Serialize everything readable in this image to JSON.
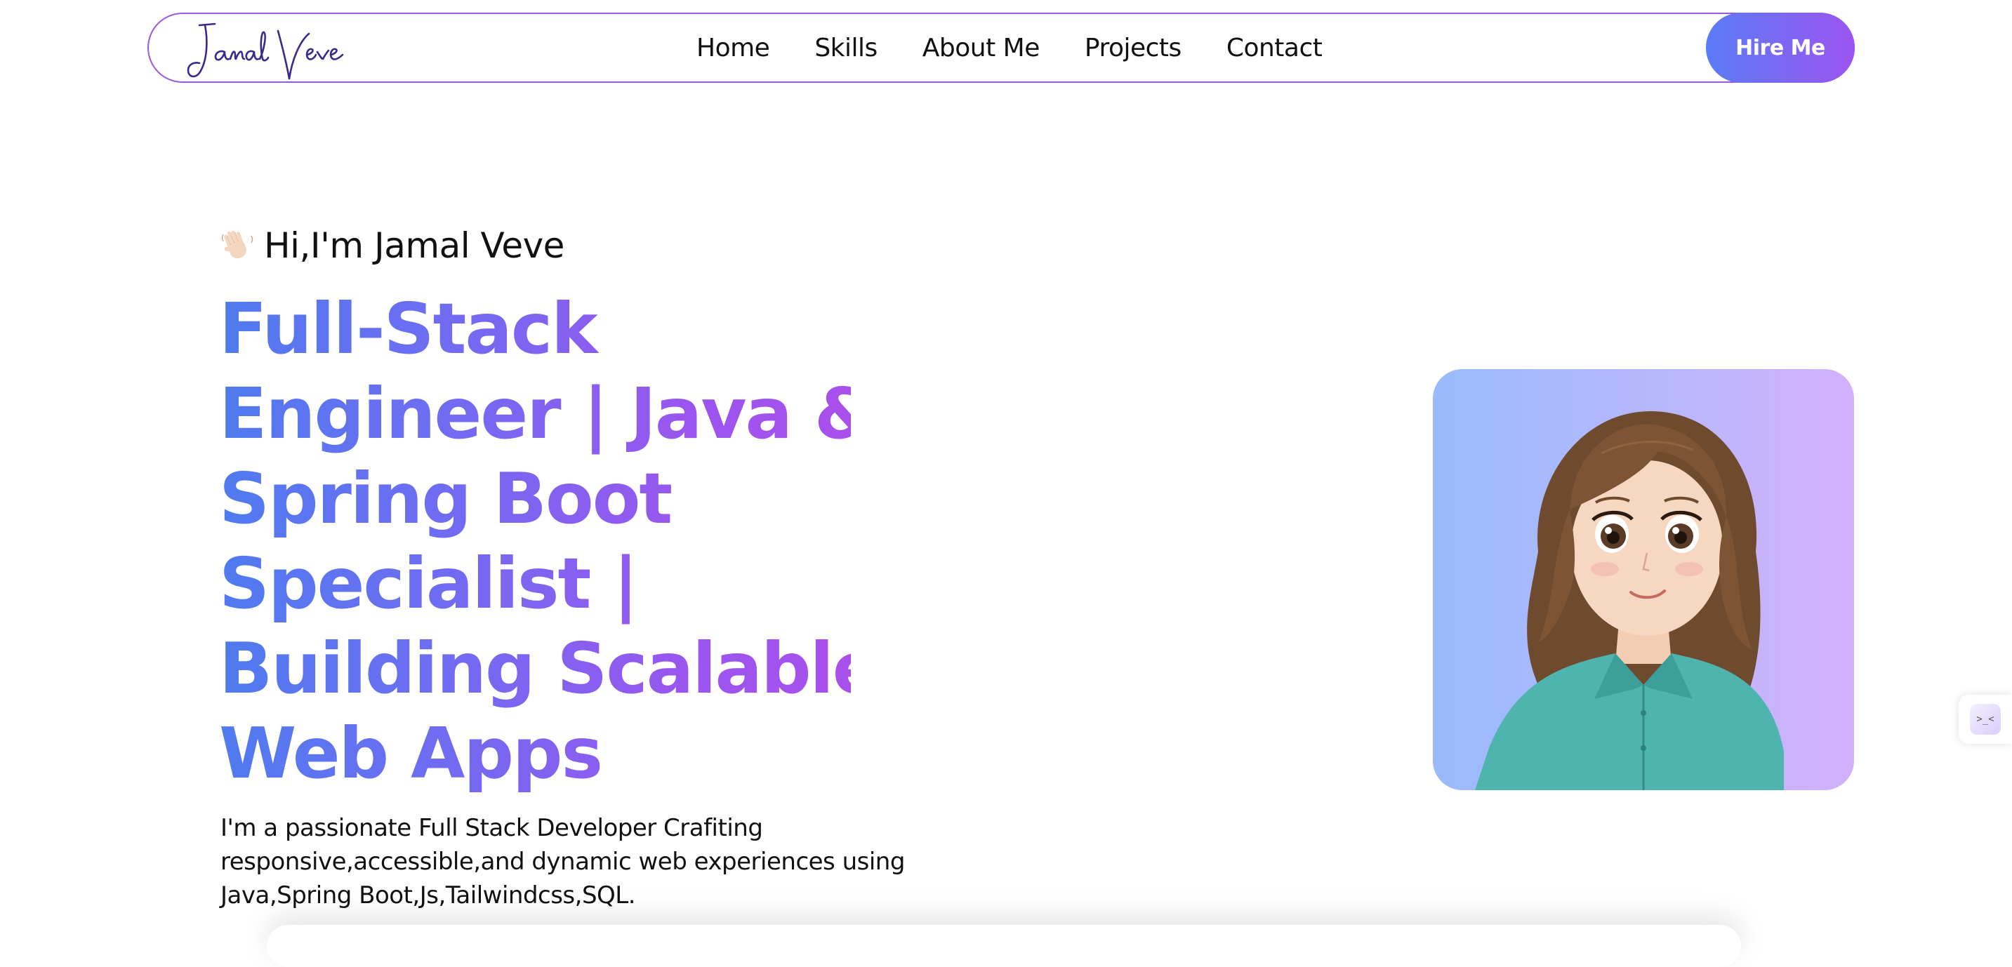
{
  "brand": {
    "logo_text": "Jamal Veve",
    "logo_color": "#3a2a8c"
  },
  "nav": {
    "links": [
      {
        "label": "Home"
      },
      {
        "label": "Skills"
      },
      {
        "label": "About Me"
      },
      {
        "label": "Projects"
      },
      {
        "label": "Contact"
      }
    ],
    "cta_label": "Hire Me"
  },
  "hero": {
    "greeting_icon": "waving-hand-icon",
    "greeting": "Hi,I'm Jamal Veve",
    "headline_lines": [
      "Full-Stack",
      "Engineer | Java &",
      "Spring Boot",
      "Specialist |",
      "Building Scalable",
      "Web Apps"
    ],
    "description_lines": [
      "I'm a passionate Full Stack Developer Crafiting",
      "responsive,accessible,and dynamic web experiences using",
      "Java,Spring Boot,Js,Tailwindcss,SQL."
    ],
    "avatar_icon": "cartoon-avatar-portrait"
  },
  "side_widget": {
    "icon": "code-brackets-icon",
    "glyph": ">_<"
  },
  "colors": {
    "accent_start": "#4f7bef",
    "accent_end": "#a94fec",
    "nav_border": "#9a5ad8",
    "text": "#111111",
    "background": "#ffffff"
  }
}
